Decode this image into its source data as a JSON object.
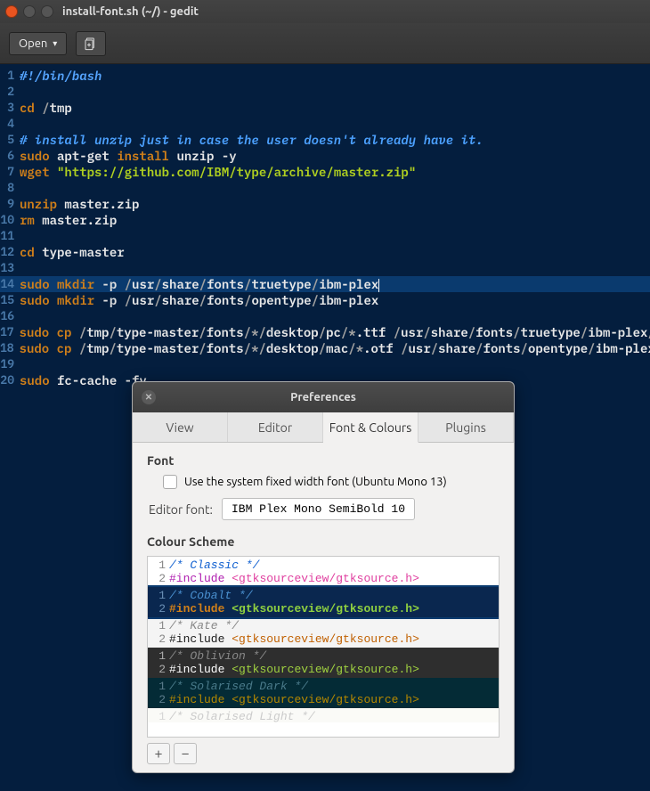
{
  "window": {
    "title": "install-font.sh (~/) - gedit"
  },
  "toolbar": {
    "open_label": "Open"
  },
  "editor": {
    "lines": [
      {
        "n": 1,
        "html": "<span class='c-sh'>#!/bin/bash</span>"
      },
      {
        "n": 2,
        "html": ""
      },
      {
        "n": 3,
        "html": "<span class='c-kw'>cd</span> <span class='c-sep'>/</span><span class='c-path'>tmp</span>"
      },
      {
        "n": 4,
        "html": ""
      },
      {
        "n": 5,
        "html": "<span class='c-cmt'># install unzip just in case the user doesn't already have it.</span>"
      },
      {
        "n": 6,
        "html": "<span class='c-kw'>sudo</span> <span class='c-cmd'>apt-get</span> <span class='c-kw'>install</span> <span class='c-cmd'>unzip</span> <span class='c-flag'>-y</span>"
      },
      {
        "n": 7,
        "html": "<span class='c-kw'>wget</span> <span class='c-str'>\"https://github.com/IBM/type/archive/master.zip\"</span>"
      },
      {
        "n": 8,
        "html": ""
      },
      {
        "n": 9,
        "html": "<span class='c-kw'>unzip</span> <span class='c-cmd'>master.zip</span>"
      },
      {
        "n": 10,
        "html": "<span class='c-kw'>rm</span> <span class='c-cmd'>master.zip</span>"
      },
      {
        "n": 11,
        "html": ""
      },
      {
        "n": 12,
        "html": "<span class='c-kw'>cd</span> <span class='c-cmd'>type-master</span>"
      },
      {
        "n": 13,
        "html": ""
      },
      {
        "n": 14,
        "sel": true,
        "html": "<span class='c-kw'>sudo</span> <span class='c-kw'>mkdir</span> <span class='c-flag'>-p</span> <span class='c-sep'>/</span><span class='c-path'>usr</span><span class='c-sep'>/</span><span class='c-path'>share</span><span class='c-sep'>/</span><span class='c-path'>fonts</span><span class='c-sep'>/</span><span class='c-path'>truetype</span><span class='c-sep'>/</span><span class='c-path'>ibm-plex</span><span class='cursor'></span>"
      },
      {
        "n": 15,
        "html": "<span class='c-kw'>sudo</span> <span class='c-kw'>mkdir</span> <span class='c-flag'>-p</span> <span class='c-sep'>/</span><span class='c-path'>usr</span><span class='c-sep'>/</span><span class='c-path'>share</span><span class='c-sep'>/</span><span class='c-path'>fonts</span><span class='c-sep'>/</span><span class='c-path'>opentype</span><span class='c-sep'>/</span><span class='c-path'>ibm-plex</span>"
      },
      {
        "n": 16,
        "html": ""
      },
      {
        "n": 17,
        "html": "<span class='c-kw'>sudo</span> <span class='c-kw'>cp</span> <span class='c-sep'>/</span><span class='c-path'>tmp</span><span class='c-sep'>/</span><span class='c-path'>type-master</span><span class='c-sep'>/</span><span class='c-path'>fonts</span><span class='c-sep'>/*/</span><span class='c-path'>desktop</span><span class='c-sep'>/</span><span class='c-path'>pc</span><span class='c-sep'>/*</span><span class='c-path'>.ttf</span> <span class='c-sep'>/</span><span class='c-path'>usr</span><span class='c-sep'>/</span><span class='c-path'>share</span><span class='c-sep'>/</span><span class='c-path'>fonts</span><span class='c-sep'>/</span><span class='c-path'>truetype</span><span class='c-sep'>/</span><span class='c-path'>ibm-plex</span><span class='c-sep'>/.</span>"
      },
      {
        "n": 18,
        "html": "<span class='c-kw'>sudo</span> <span class='c-kw'>cp</span> <span class='c-sep'>/</span><span class='c-path'>tmp</span><span class='c-sep'>/</span><span class='c-path'>type-master</span><span class='c-sep'>/</span><span class='c-path'>fonts</span><span class='c-sep'>/*/</span><span class='c-path'>desktop</span><span class='c-sep'>/</span><span class='c-path'>mac</span><span class='c-sep'>/*</span><span class='c-path'>.otf</span> <span class='c-sep'>/</span><span class='c-path'>usr</span><span class='c-sep'>/</span><span class='c-path'>share</span><span class='c-sep'>/</span><span class='c-path'>fonts</span><span class='c-sep'>/</span><span class='c-path'>opentype</span><span class='c-sep'>/</span><span class='c-path'>ibm-plex</span><span class='c-sep'>/.</span>"
      },
      {
        "n": 19,
        "html": ""
      },
      {
        "n": 20,
        "html": "<span class='c-kw'>sudo</span> <span class='c-cmd'>fc-cache</span> <span class='c-flag'>-fv</span>"
      }
    ]
  },
  "dialog": {
    "title": "Preferences",
    "tabs": [
      "View",
      "Editor",
      "Font & Colours",
      "Plugins"
    ],
    "active_tab": 2,
    "font": {
      "section": "Font",
      "use_system_label": "Use the system fixed width font (Ubuntu Mono 13)",
      "editor_font_label": "Editor font:",
      "editor_font_value": "IBM Plex Mono SemiBold 10"
    },
    "colour_scheme": {
      "section": "Colour Scheme",
      "items": [
        {
          "name": "Classic",
          "cls": "scheme0"
        },
        {
          "name": "Cobalt",
          "cls": "scheme1",
          "selected": true
        },
        {
          "name": "Kate",
          "cls": "scheme2"
        },
        {
          "name": "Oblivion",
          "cls": "scheme3"
        },
        {
          "name": "Solarised Dark",
          "cls": "scheme4"
        },
        {
          "name": "Solarised Light",
          "cls": "scheme5",
          "cut": true
        }
      ],
      "preview_include": "#include",
      "preview_header": "<gtksourceview/gtksource.h>",
      "add_label": "+",
      "remove_label": "−"
    }
  }
}
